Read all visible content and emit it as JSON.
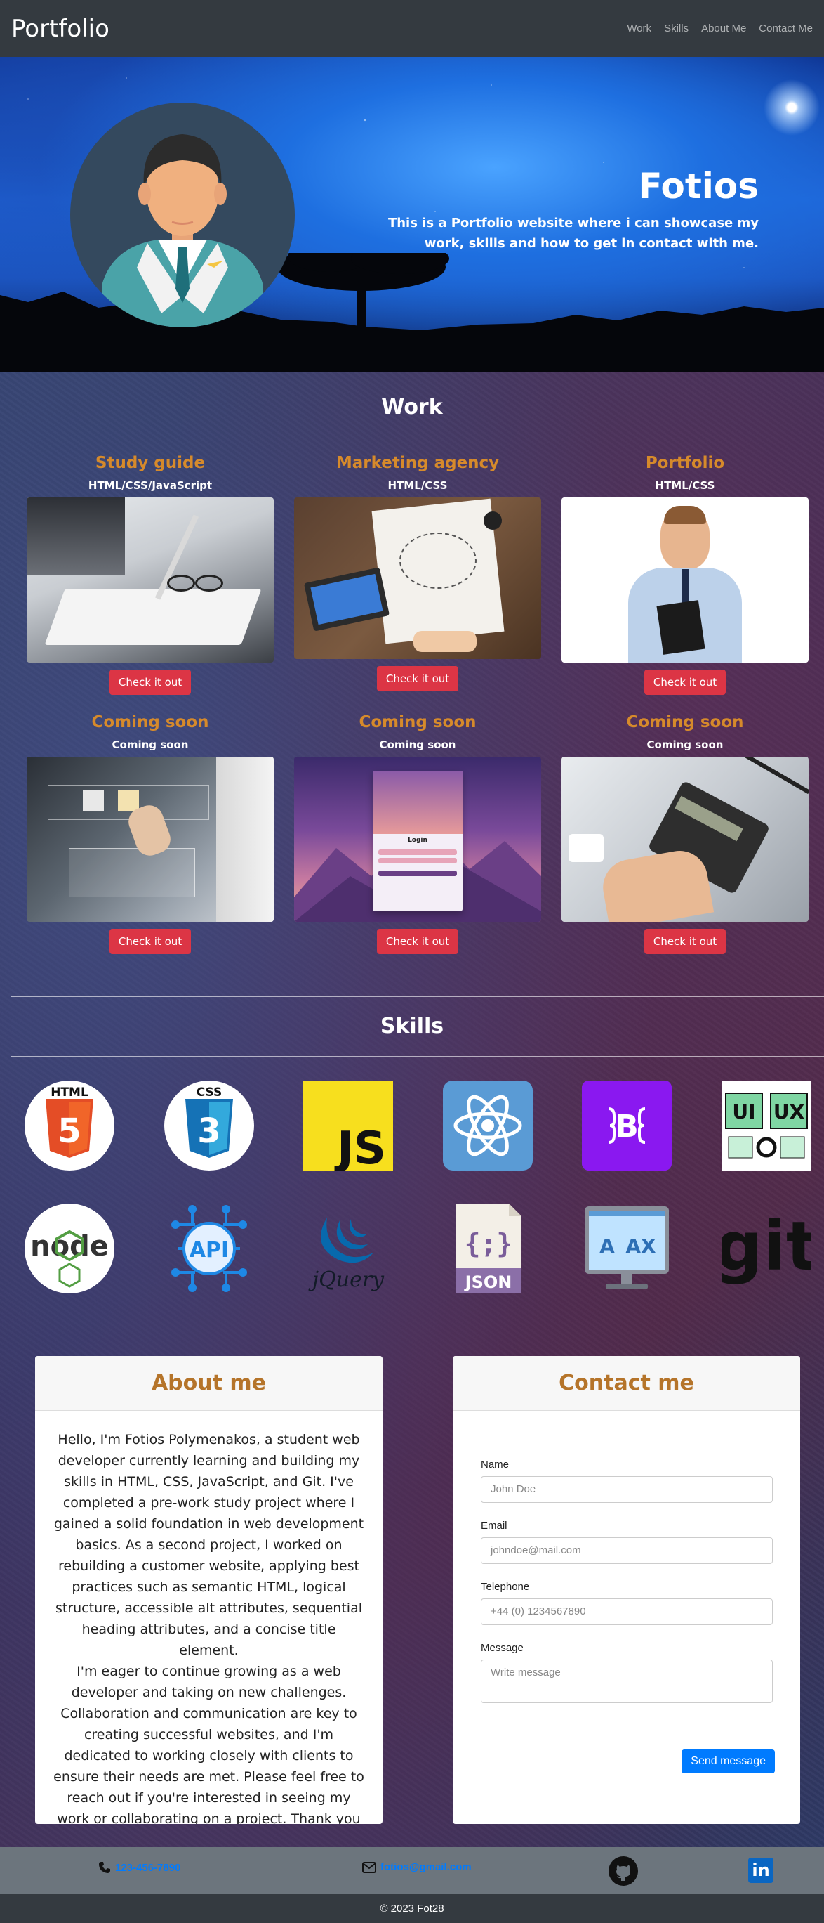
{
  "nav": {
    "brand": "Portfolio",
    "links": [
      "Work",
      "Skills",
      "About Me",
      "Contact Me"
    ]
  },
  "hero": {
    "title": "Fotios",
    "subtitle": "This is a Portfolio website where i can showcase my work, skills and how to get in contact with me."
  },
  "work": {
    "title": "Work",
    "cards": [
      {
        "title": "Study guide",
        "tech": "HTML/CSS/JavaScript",
        "button": "Check it out",
        "image": "study-photo"
      },
      {
        "title": "Marketing agency",
        "tech": "HTML/CSS",
        "button": "Check it out",
        "image": "marketing-desk-photo"
      },
      {
        "title": "Portfolio",
        "tech": "HTML/CSS",
        "button": "Check it out",
        "image": "businessman-photo"
      },
      {
        "title": "Coming soon",
        "tech": "Coming soon",
        "button": "Check it out",
        "image": "shopping-screen-photo"
      },
      {
        "title": "Coming soon",
        "tech": "Coming soon",
        "button": "Check it out",
        "image": "login-illustration"
      },
      {
        "title": "Coming soon",
        "tech": "Coming soon",
        "button": "Check it out",
        "image": "calculator-photo"
      }
    ]
  },
  "skills": {
    "title": "Skills",
    "icons": [
      "html5-icon",
      "css3-icon",
      "javascript-icon",
      "react-icon",
      "bootstrap-icon",
      "ui-ux-icon",
      "nodejs-icon",
      "api-icon",
      "jquery-icon",
      "json-icon",
      "translate-icon",
      "git-icon"
    ],
    "labels": {
      "html": "HTML",
      "css": "CSS",
      "js": "JS",
      "bootstrap": "B",
      "ui": "UI",
      "ux": "UX",
      "node": "node",
      "api": "API",
      "jquery": "jQuery",
      "json": "JSON",
      "ax": "A",
      "ax2": "AX",
      "git": "git"
    }
  },
  "about": {
    "title": "About me",
    "p1": "Hello, I'm Fotios Polymenakos, a student web developer currently learning and building my skills in HTML, CSS, JavaScript, and Git. I've completed a pre-work study project where I gained a solid foundation in web development basics. As a second project, I worked on rebuilding a customer website, applying best practices such as semantic HTML, logical structure, accessible alt attributes, sequential heading attributes, and a concise title element.",
    "p2": "I'm eager to continue growing as a web developer and taking on new challenges. Collaboration and communication are key to creating successful websites, and I'm dedicated to working closely with clients to ensure their needs are met. Please feel free to reach out if you're interested in seeing my work or collaborating on a project. Thank you for considering my portfolio!"
  },
  "contact": {
    "title": "Contact me",
    "name_label": "Name",
    "name_placeholder": "John Doe",
    "email_label": "Email",
    "email_placeholder": "johndoe@mail.com",
    "phone_label": "Telephone",
    "phone_placeholder": "+44 (0) 1234567890",
    "message_label": "Message",
    "message_placeholder": "Write message",
    "send": "Send message"
  },
  "footer": {
    "phone": "123-456-7890",
    "email": "fotios@gmail.com",
    "linkedin": "in",
    "copyright": "© 2023 Fot28"
  },
  "colors": {
    "accent_orange": "#d68a2b",
    "button_red": "#dc3545",
    "primary_blue": "#007bff",
    "nav_dark": "#343a40"
  }
}
